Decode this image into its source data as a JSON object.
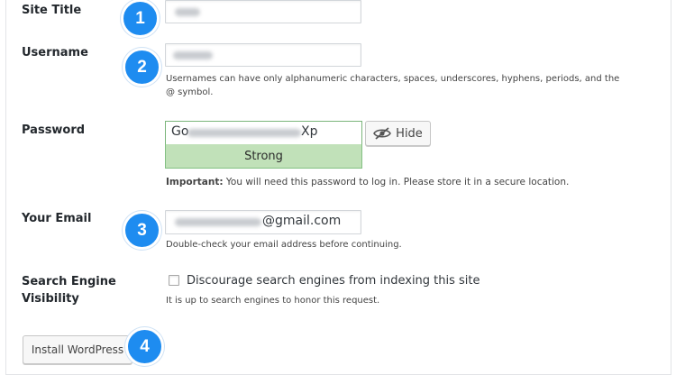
{
  "labels": {
    "site_title": "Site Title",
    "username": "Username",
    "password": "Password",
    "email": "Your Email",
    "search_line1": "Search Engine",
    "search_line2": "Visibility"
  },
  "username": {
    "hint": "Usernames can have only alphanumeric characters, spaces, underscores, hyphens, periods, and the @ symbol."
  },
  "password": {
    "prefix": "Go",
    "suffix": "Xp",
    "strength": "Strong",
    "hide_label": "Hide",
    "note_bold": "Important:",
    "note_text": " You will need this password to log in. Please store it in a secure location."
  },
  "email": {
    "domain": "@gmail.com",
    "hint": "Double-check your email address before continuing."
  },
  "search": {
    "checkbox_label": "Discourage search engines from indexing this site",
    "hint": "It is up to search engines to honor this request."
  },
  "install": {
    "label": "Install WordPress"
  },
  "steps": [
    "1",
    "2",
    "3",
    "4"
  ],
  "colors": {
    "badge": "#1e8cf0",
    "strength_bg": "#c1e1b9"
  },
  "icons": {
    "hide": "eye-slash-icon"
  }
}
